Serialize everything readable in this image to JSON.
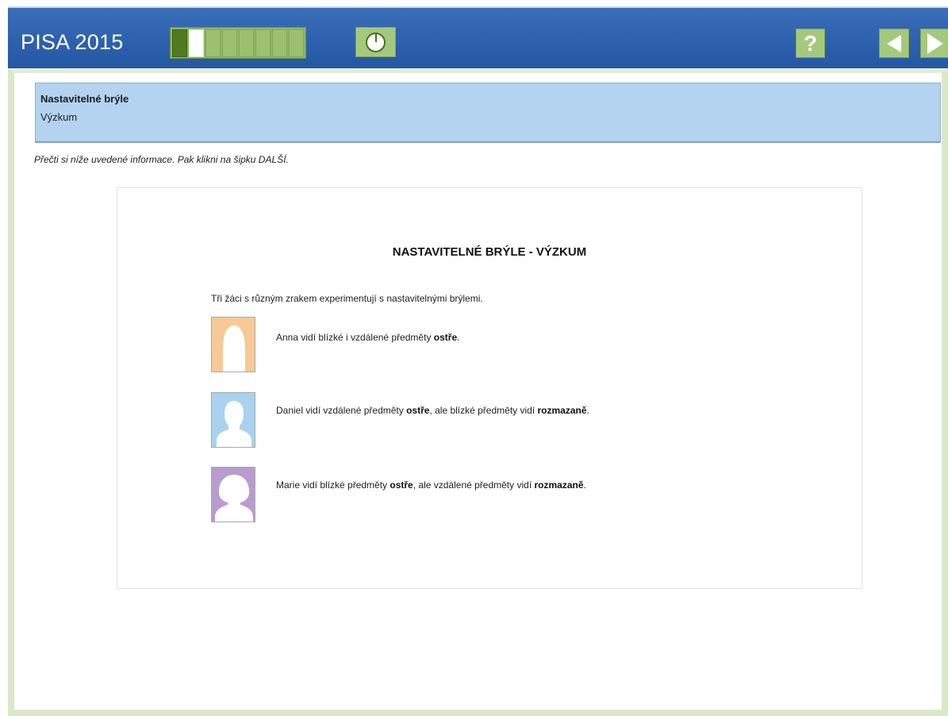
{
  "app": {
    "title": "PISA 2015"
  },
  "progress": {
    "segments": 8,
    "completed": 1,
    "current_index": 1
  },
  "toolbar": {
    "timer_icon": "timer-icon",
    "help_label": "?",
    "prev_icon": "arrow-left-icon",
    "next_icon": "arrow-right-icon"
  },
  "unit": {
    "title": "Nastavitelné brýle",
    "subtitle": "Výzkum"
  },
  "instruction": "Přečti si níže uvedené informace. Pak klikni na šipku DALŠÍ.",
  "stimulus": {
    "title": "NASTAVITELNÉ BRÝLE - VÝZKUM",
    "intro": "Tři žáci s různým zrakem experimentují s nastavitelnými brýlemi.",
    "people": [
      {
        "name": "Anna",
        "color": "#f7c996",
        "text_a": "Anna vidí blízké i vzdálené předměty ",
        "bold_a": "ostře",
        "text_b": ".",
        "bold_b": "",
        "text_c": ""
      },
      {
        "name": "Daniel",
        "color": "#a9d2ef",
        "text_a": "Daniel vidí vzdálené předměty ",
        "bold_a": "ostře",
        "text_b": ", ale blízké předměty vidí ",
        "bold_b": "rozmazaně",
        "text_c": "."
      },
      {
        "name": "Marie",
        "color": "#b89ccd",
        "text_a": "Marie vidí blízké předměty ",
        "bold_a": "ostře",
        "text_b": ", ale vzdálené předměty vidí ",
        "bold_b": "rozmazaně",
        "text_c": "."
      }
    ]
  },
  "colors": {
    "topbar": "#2457a4",
    "button_green": "#a5c97c",
    "header_blue": "#b3d3f0",
    "frame_green": "#dbe8c8"
  }
}
